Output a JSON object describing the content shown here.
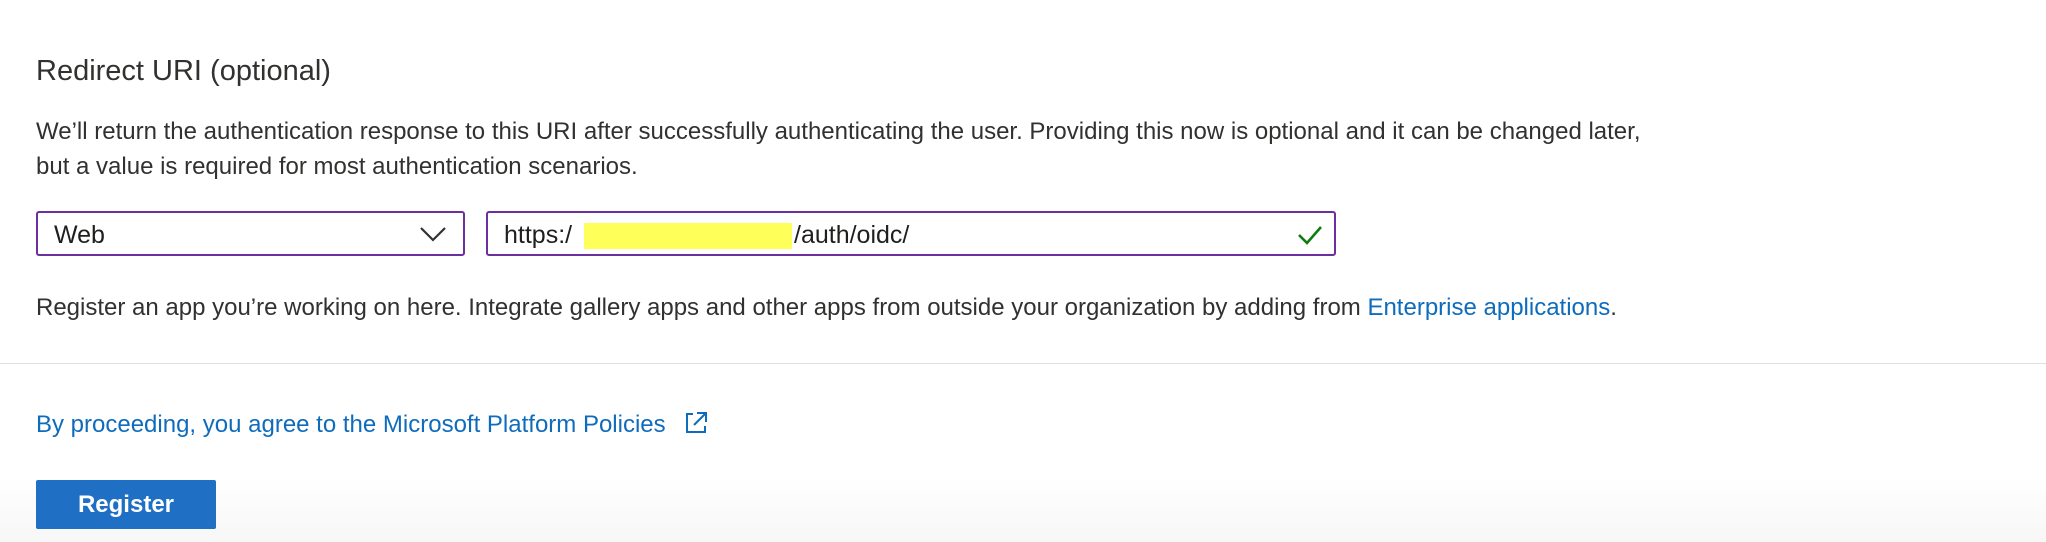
{
  "section": {
    "title": "Redirect URI (optional)",
    "description": "We’ll return the authentication response to this URI after successfully authenticating the user. Providing this now is optional and it can be changed later, but a value is required for most authentication scenarios."
  },
  "redirect": {
    "platform_value": "Web",
    "uri_prefix": "https:/",
    "uri_suffix": "/auth/oidc/",
    "redaction_color": "#ffff5a",
    "valid_icon": "checkmark-icon",
    "dropdown_icon": "chevron-down-icon"
  },
  "note": {
    "text": "Register an app you’re working on here. Integrate gallery apps and other apps from outside your organization by adding from ",
    "link": "Enterprise applications",
    "trailing": "."
  },
  "policy": {
    "link": "By proceeding, you agree to the Microsoft Platform Policies",
    "icon": "external-link-icon"
  },
  "actions": {
    "register_label": "Register"
  },
  "colors": {
    "border_active": "#6b2fa0",
    "link": "#0f6cbd",
    "primary_button": "#1f6fc5",
    "success_check": "#107c10"
  }
}
